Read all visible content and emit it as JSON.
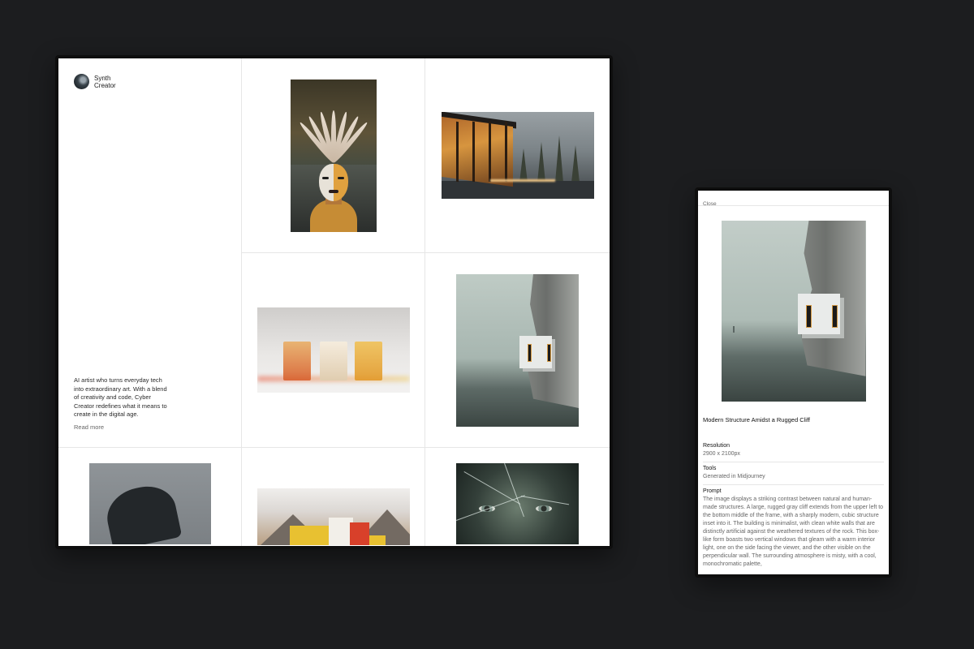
{
  "profile": {
    "name": "Synth\nCreator",
    "bio": "AI artist who turns everyday tech into extraordinary art. With a blend of creativity and code, Cyber Creator redefines what it means to create in the digital age.",
    "read_more": "Read more"
  },
  "gallery": {
    "items": [
      {
        "subject": "portrait-with-feather-headdress"
      },
      {
        "subject": "glass-house-in-misty-forest"
      },
      {
        "subject": "glowing-translucent-cubes"
      },
      {
        "subject": "cube-house-in-cliff"
      },
      {
        "subject": "dark-brush-stroke-figure"
      },
      {
        "subject": "colorful-blocks-in-desert"
      },
      {
        "subject": "face-behind-cracked-glass"
      }
    ]
  },
  "detail": {
    "close_label": "Close",
    "title": "Modern Structure Amidst a Rugged Cliff",
    "resolution_label": "Resolution",
    "resolution_value": "2900 x 2100px",
    "tools_label": "Tools",
    "tools_value": "Generated in Midjourney",
    "prompt_label": "Prompt",
    "prompt_text": "The image displays a striking contrast between natural and human-made structures. A large, rugged gray cliff extends from the upper left to the bottom middle of the frame, with a sharply modern, cubic structure inset into it. The building is minimalist, with clean white walls that are distinctly artificial against the weathered textures of the rock. This box-like form boasts two vertical windows that gleam with a warm interior light, one on the side facing the viewer, and the other visible on the perpendicular wall. The surrounding atmosphere is misty, with a cool, monochromatic palette,"
  },
  "colors": {
    "background": "#1c1d1f",
    "frame": "#0e0e0e",
    "surface": "#ffffff",
    "divider": "#e6e6e6",
    "text_primary": "#111111",
    "text_secondary": "#666666"
  },
  "icons": [
    "avatar"
  ]
}
